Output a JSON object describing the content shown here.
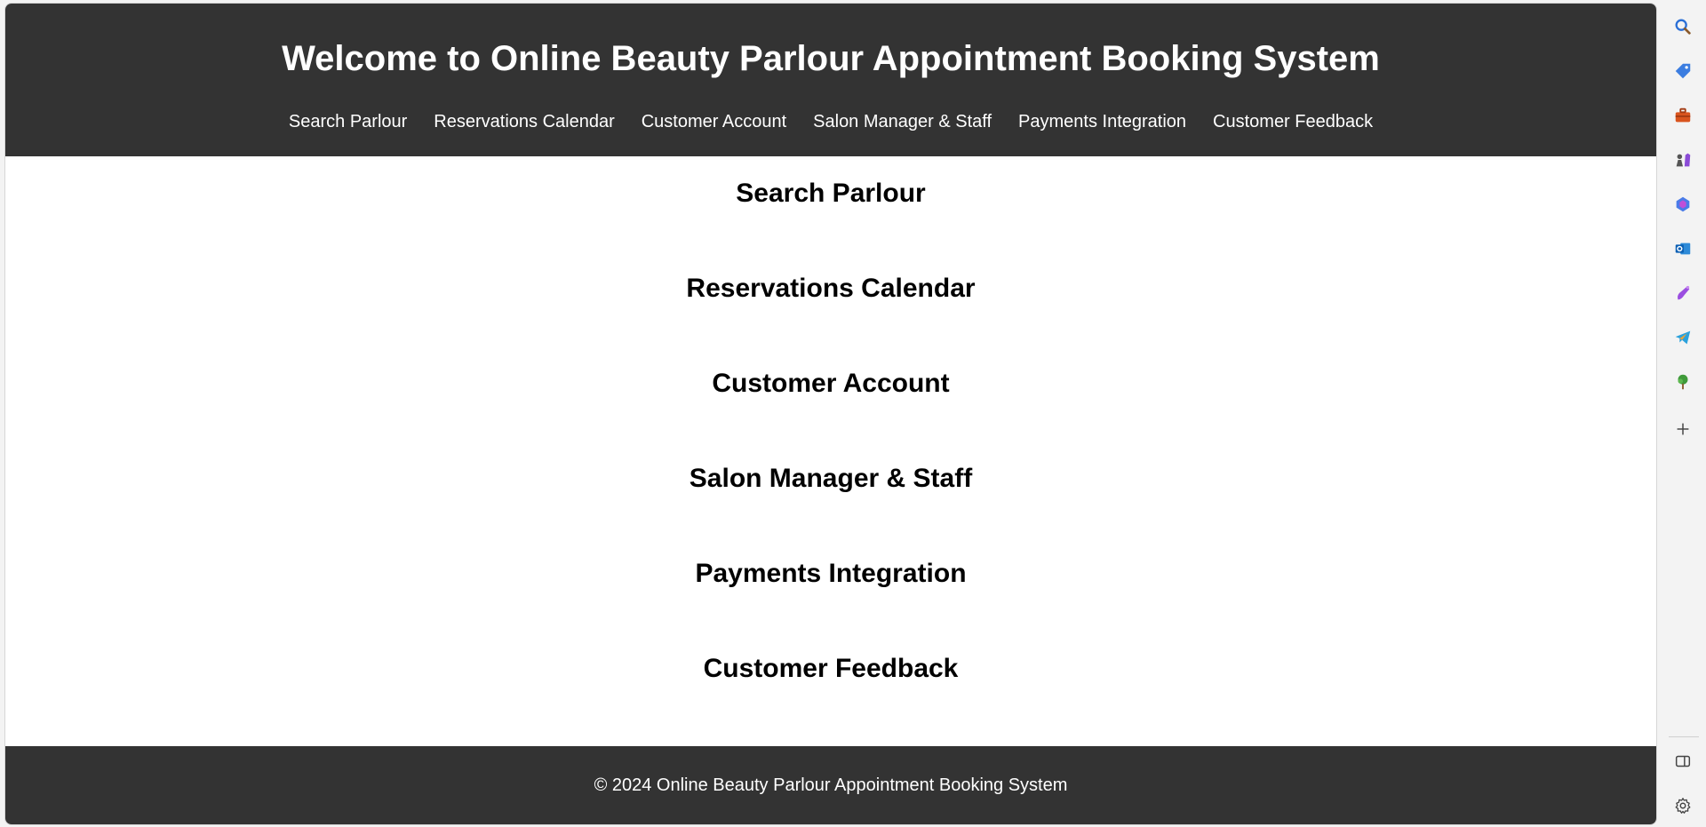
{
  "header": {
    "title": "Welcome to Online Beauty Parlour Appointment Booking System"
  },
  "nav": {
    "items": [
      {
        "label": "Search Parlour"
      },
      {
        "label": "Reservations Calendar"
      },
      {
        "label": "Customer Account"
      },
      {
        "label": "Salon Manager & Staff"
      },
      {
        "label": "Payments Integration"
      },
      {
        "label": "Customer Feedback"
      }
    ]
  },
  "sections": [
    {
      "heading": "Search Parlour"
    },
    {
      "heading": "Reservations Calendar"
    },
    {
      "heading": "Customer Account"
    },
    {
      "heading": "Salon Manager & Staff"
    },
    {
      "heading": "Payments Integration"
    },
    {
      "heading": "Customer Feedback"
    }
  ],
  "footer": {
    "text": "© 2024 Online Beauty Parlour Appointment Booking System"
  },
  "theme": {
    "header_bg": "#333333",
    "header_fg": "#ffffff",
    "page_bg": "#ffffff"
  },
  "edge_sidebar": {
    "icons": [
      "search-icon",
      "tag-icon",
      "toolbox-icon",
      "chess-icon",
      "copilot-icon",
      "outlook-icon",
      "designer-icon",
      "telegram-icon",
      "tree-icon",
      "plus-icon",
      "split-screen-icon",
      "settings-icon"
    ]
  }
}
